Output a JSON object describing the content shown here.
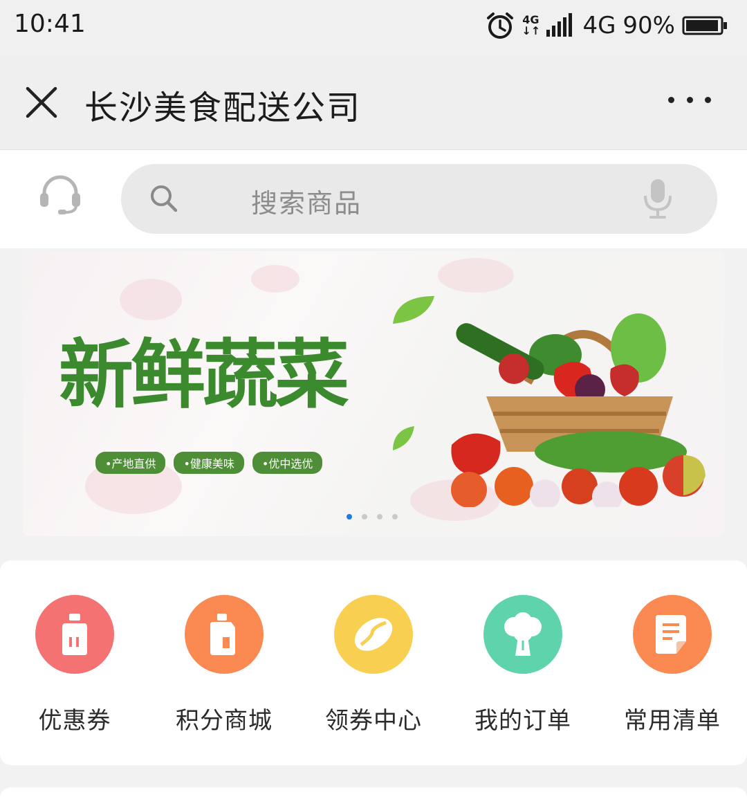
{
  "status_bar": {
    "time": "10:41",
    "net_small_top": "4G",
    "net_small_bottom": "↓↑",
    "network": "4G",
    "battery": "90%",
    "icons": [
      "alarm-icon",
      "signal-icon",
      "battery-icon"
    ]
  },
  "nav": {
    "title": "长沙美食配送公司",
    "close_icon": "close-icon",
    "more_icon": "more-icon"
  },
  "search": {
    "placeholder": "搜索商品",
    "icons": [
      "headset-icon",
      "search-icon",
      "microphone-icon"
    ]
  },
  "banner": {
    "slogan": "新鲜蔬菜",
    "tags": [
      "•产地直供",
      "•健康美味",
      "•优中选优"
    ],
    "dots_total": 4,
    "active_dot": 1,
    "brand_green": "#3c8a2e"
  },
  "quick_menu": {
    "items": [
      {
        "label": "优惠券",
        "icon": "bottle-icon",
        "color": "#f47272"
      },
      {
        "label": "积分商城",
        "icon": "jug-icon",
        "color": "#fa8a52"
      },
      {
        "label": "领券中心",
        "icon": "bean-icon",
        "color": "#f9cf52"
      },
      {
        "label": "我的订单",
        "icon": "broccoli-icon",
        "color": "#5fd3ac"
      },
      {
        "label": "常用清单",
        "icon": "document-icon",
        "color": "#fa8a52"
      }
    ]
  }
}
